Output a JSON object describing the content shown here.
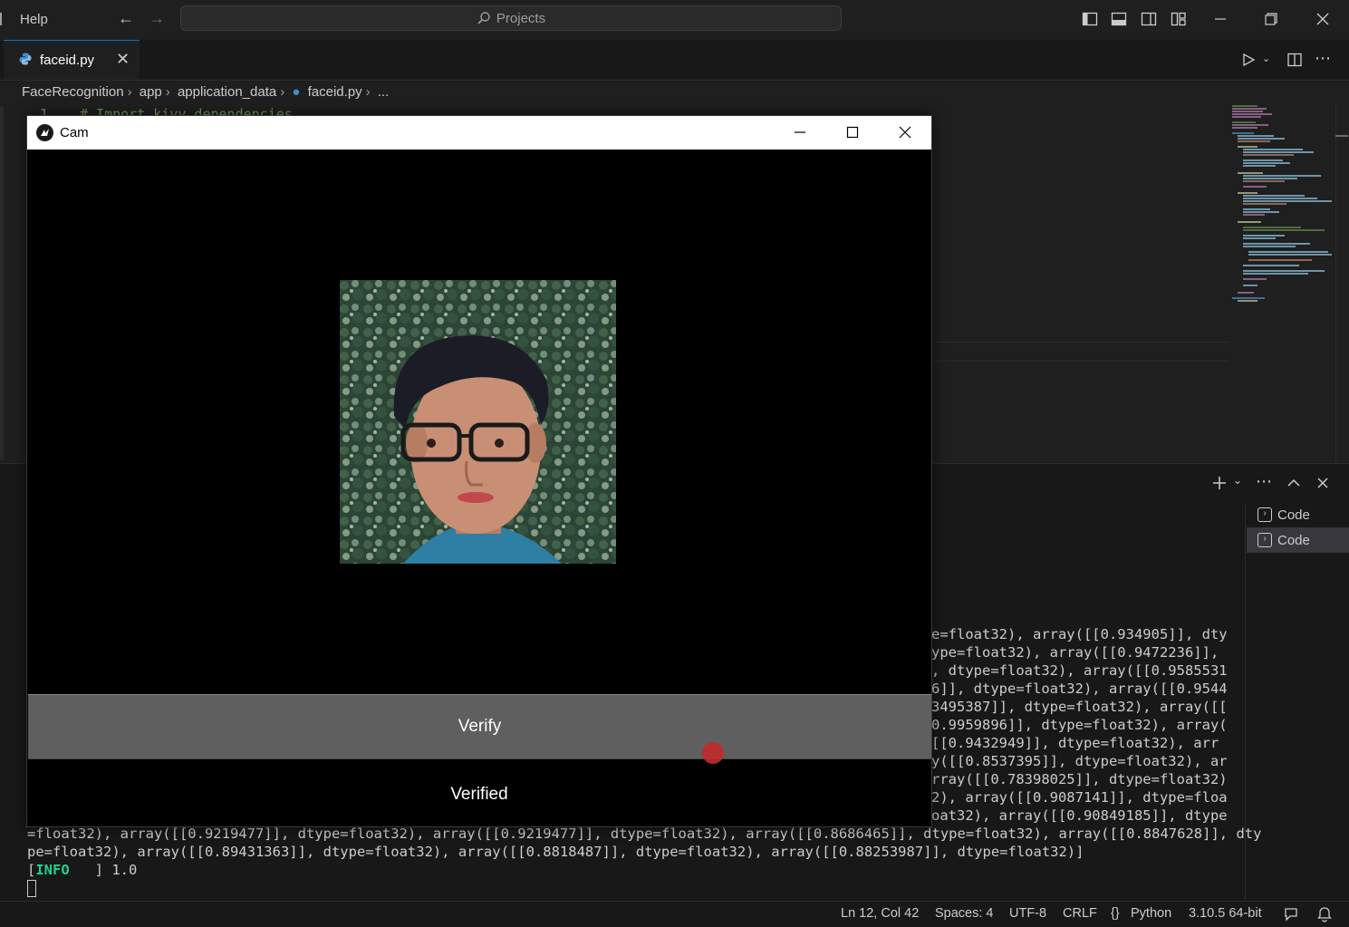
{
  "titlebar": {
    "menu_help": "Help",
    "search_placeholder": "Projects"
  },
  "tab": {
    "label": "faceid.py"
  },
  "breadcrumb": [
    "FaceRecognition",
    "app",
    "application_data",
    "faceid.py",
    "..."
  ],
  "editor": {
    "first_line_number": "1",
    "first_line_text": "# Import kivy dependencies"
  },
  "cam_window": {
    "title": "Cam",
    "verify_button": "Verify",
    "status_label": "Verified"
  },
  "panel": {
    "terminals": [
      "Code",
      "Code"
    ],
    "output_right": [
      "e=float32), array([[0.934905]], dty",
      "ype=float32), array([[0.9472236]],",
      ", dtype=float32), array([[0.9585531",
      "6]], dtype=float32), array([[0.9544",
      "3495387]], dtype=float32), array([[",
      "0.9959896]], dtype=float32), array(",
      "[[0.9432949]], dtype=float32), arr",
      "y([[0.8537395]], dtype=float32), ar",
      "rray([[0.78398025]], dtype=float32)",
      "2), array([[0.9087141]], dtype=floa",
      "oat32), array([[0.90849185]], dtype"
    ],
    "output_full": [
      "=float32), array([[0.9219477]], dtype=float32), array([[0.9219477]], dtype=float32), array([[0.8686465]], dtype=float32), array([[0.8847628]], dty",
      "pe=float32), array([[0.89431363]], dtype=float32), array([[0.8818487]], dtype=float32), array([[0.88253987]], dtype=float32)]"
    ],
    "info_tag": "INFO",
    "info_line": "   ] 1.0"
  },
  "statusbar": {
    "position": "Ln 12, Col 42",
    "spaces": "Spaces: 4",
    "encoding": "UTF-8",
    "eol": "CRLF",
    "language": "Python",
    "interpreter": "3.10.5 64-bit"
  },
  "colors": {
    "accent": "#0078d4",
    "info_green": "#23d18b",
    "verify_button": "#5f5f5f",
    "cursor_dot": "#c22a2a"
  }
}
